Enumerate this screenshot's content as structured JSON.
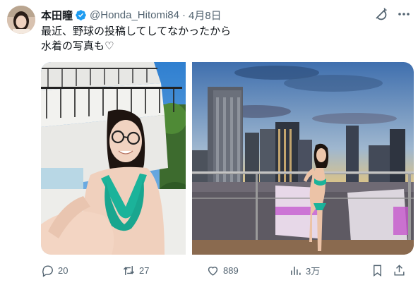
{
  "post": {
    "author_name": "本田瞳",
    "handle": "@Honda_Hitomi84",
    "separator": "·",
    "date": "4月8日",
    "text": "最近、野球の投稿してしてなかったから\n水着の写真も♡"
  },
  "actions": {
    "replies": "20",
    "reposts": "27",
    "likes": "889",
    "views": "3万"
  },
  "colors": {
    "text_primary": "#0f1419",
    "text_secondary": "#536471",
    "verified_blue": "#1d9bf0",
    "swimsuit_green": "#1bb39a"
  },
  "icons": [
    "verified-badge-icon",
    "grok-icon",
    "more-icon",
    "reply-icon",
    "repost-icon",
    "like-icon",
    "views-icon",
    "bookmark-icon",
    "share-icon"
  ]
}
